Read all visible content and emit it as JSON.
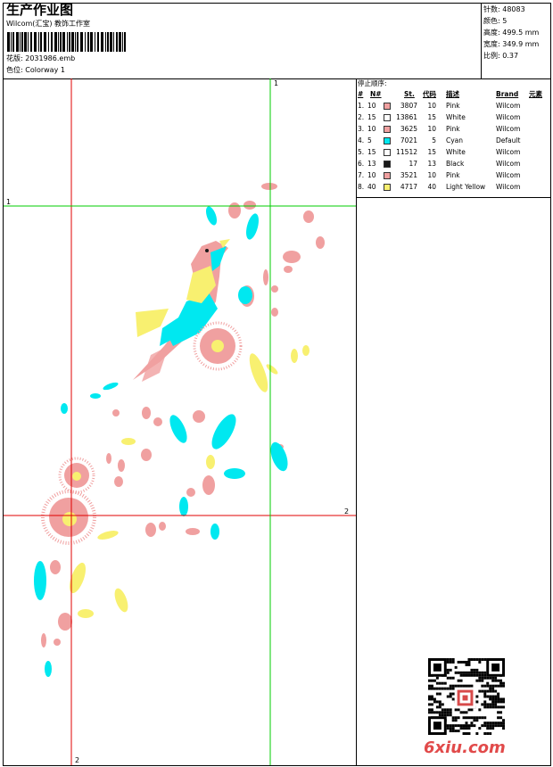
{
  "header": {
    "title": "生产作业图",
    "studio": "Wilcom(汇宝) 教饰工作室",
    "file": "花版:  2031986.emb",
    "colorway": "色位:  Colorway 1"
  },
  "stats": [
    {
      "label": "针数:",
      "value": "48083"
    },
    {
      "label": "颜色:",
      "value": "5"
    },
    {
      "label": "高度:",
      "value": "499.5 mm"
    },
    {
      "label": "宽度:",
      "value": "349.9 mm"
    },
    {
      "label": "比例:",
      "value": "0.37"
    }
  ],
  "legend": {
    "title": "停止顺序:",
    "headers": {
      "hash": "#",
      "no": "N#",
      "st": "St.",
      "code": "代码",
      "desc": "描述",
      "brand": "Brand",
      "elem": "元素"
    },
    "rows": [
      {
        "idx": "1.",
        "n": "10",
        "color": "#f0a0a0",
        "st": "3807",
        "code": "10",
        "desc": "Pink",
        "brand": "Wilcom"
      },
      {
        "idx": "2.",
        "n": "15",
        "color": "#ffffff",
        "st": "13861",
        "code": "15",
        "desc": "White",
        "brand": "Wilcom"
      },
      {
        "idx": "3.",
        "n": "10",
        "color": "#f0a0a0",
        "st": "3625",
        "code": "10",
        "desc": "Pink",
        "brand": "Wilcom"
      },
      {
        "idx": "4.",
        "n": "5",
        "color": "#00e8f0",
        "st": "7021",
        "code": "5",
        "desc": "Cyan",
        "brand": "Default"
      },
      {
        "idx": "5.",
        "n": "15",
        "color": "#ffffff",
        "st": "11512",
        "code": "15",
        "desc": "White",
        "brand": "Wilcom"
      },
      {
        "idx": "6.",
        "n": "13",
        "color": "#1a1a1a",
        "st": "17",
        "code": "13",
        "desc": "Black",
        "brand": "Wilcom"
      },
      {
        "idx": "7.",
        "n": "10",
        "color": "#f0a0a0",
        "st": "3521",
        "code": "10",
        "desc": "Pink",
        "brand": "Wilcom"
      },
      {
        "idx": "8.",
        "n": "40",
        "color": "#f8f070",
        "st": "4717",
        "code": "40",
        "desc": "Light Yellow",
        "brand": "Wilcom"
      }
    ]
  },
  "guides": {
    "top": "1",
    "left": "1",
    "right": "2",
    "bottom": "2"
  },
  "colors": {
    "pink": "#f0a0a0",
    "cyan": "#00e8f0",
    "yellow": "#f8f070",
    "red_guide": "#e00000",
    "green_guide": "#00cc00"
  },
  "watermark": "6xiu.com"
}
